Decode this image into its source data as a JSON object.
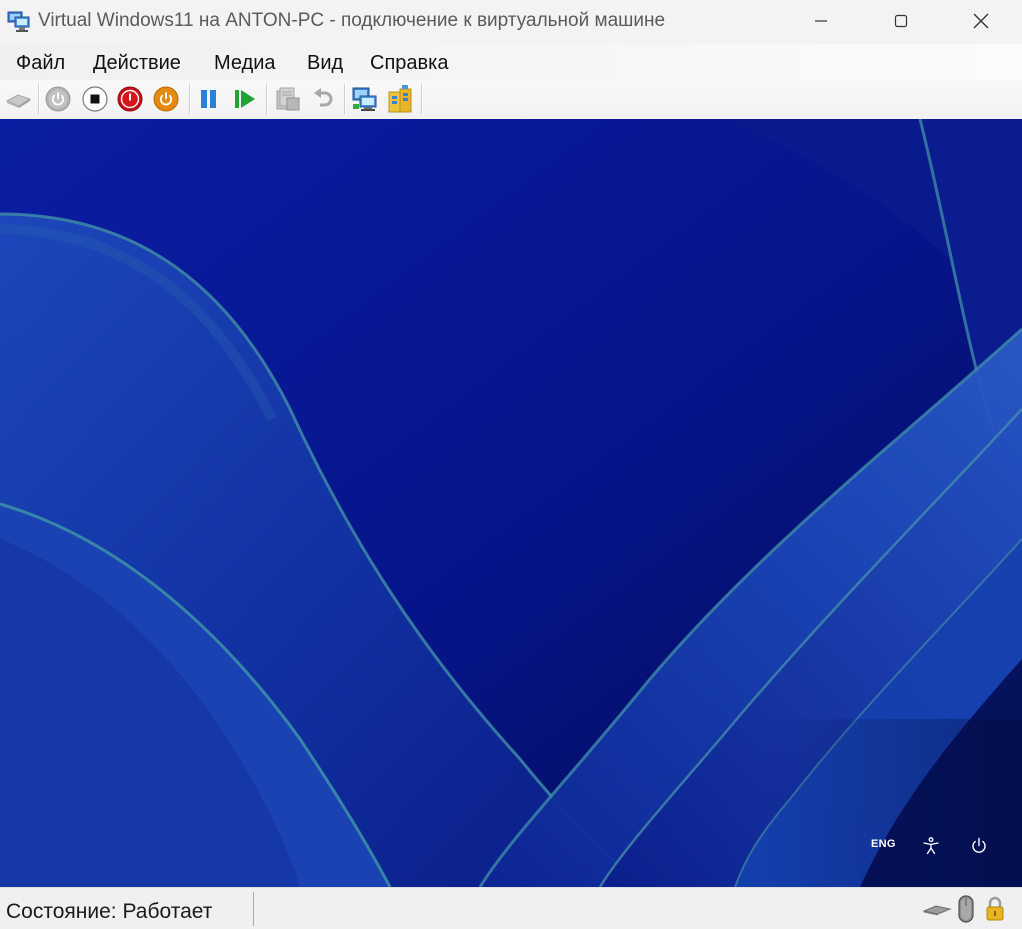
{
  "window": {
    "title": "Virtual Windows11 на ANTON-PC - подключение к виртуальной машине",
    "controls": {
      "minimize_icon": "minimize-icon",
      "maximize_icon": "maximize-icon",
      "close_icon": "close-icon"
    }
  },
  "menu": {
    "items": [
      {
        "label": "Файл"
      },
      {
        "label": "Действие"
      },
      {
        "label": "Медиа"
      },
      {
        "label": "Вид"
      },
      {
        "label": "Справка"
      }
    ]
  },
  "toolbar": {
    "icons": [
      "ctrl-alt-del-icon",
      "start-icon",
      "turn-off-icon",
      "shutdown-icon",
      "save-icon",
      "pause-icon",
      "resume-icon",
      "checkpoint-icon",
      "revert-icon",
      "enhanced-session-icon",
      "share-icon"
    ]
  },
  "vm": {
    "tray": {
      "language": "ENG",
      "accessibility_icon": "accessibility-icon",
      "power_icon": "power-icon"
    }
  },
  "status": {
    "text": "Состояние: Работает",
    "icons": [
      "keyboard-icon",
      "mouse-icon",
      "lock-icon"
    ]
  },
  "colors": {
    "wallpaper_base": "#06137a",
    "wallpaper_ribbon": "#1c47b8",
    "ribbon_edge": "#3f8fa8"
  }
}
